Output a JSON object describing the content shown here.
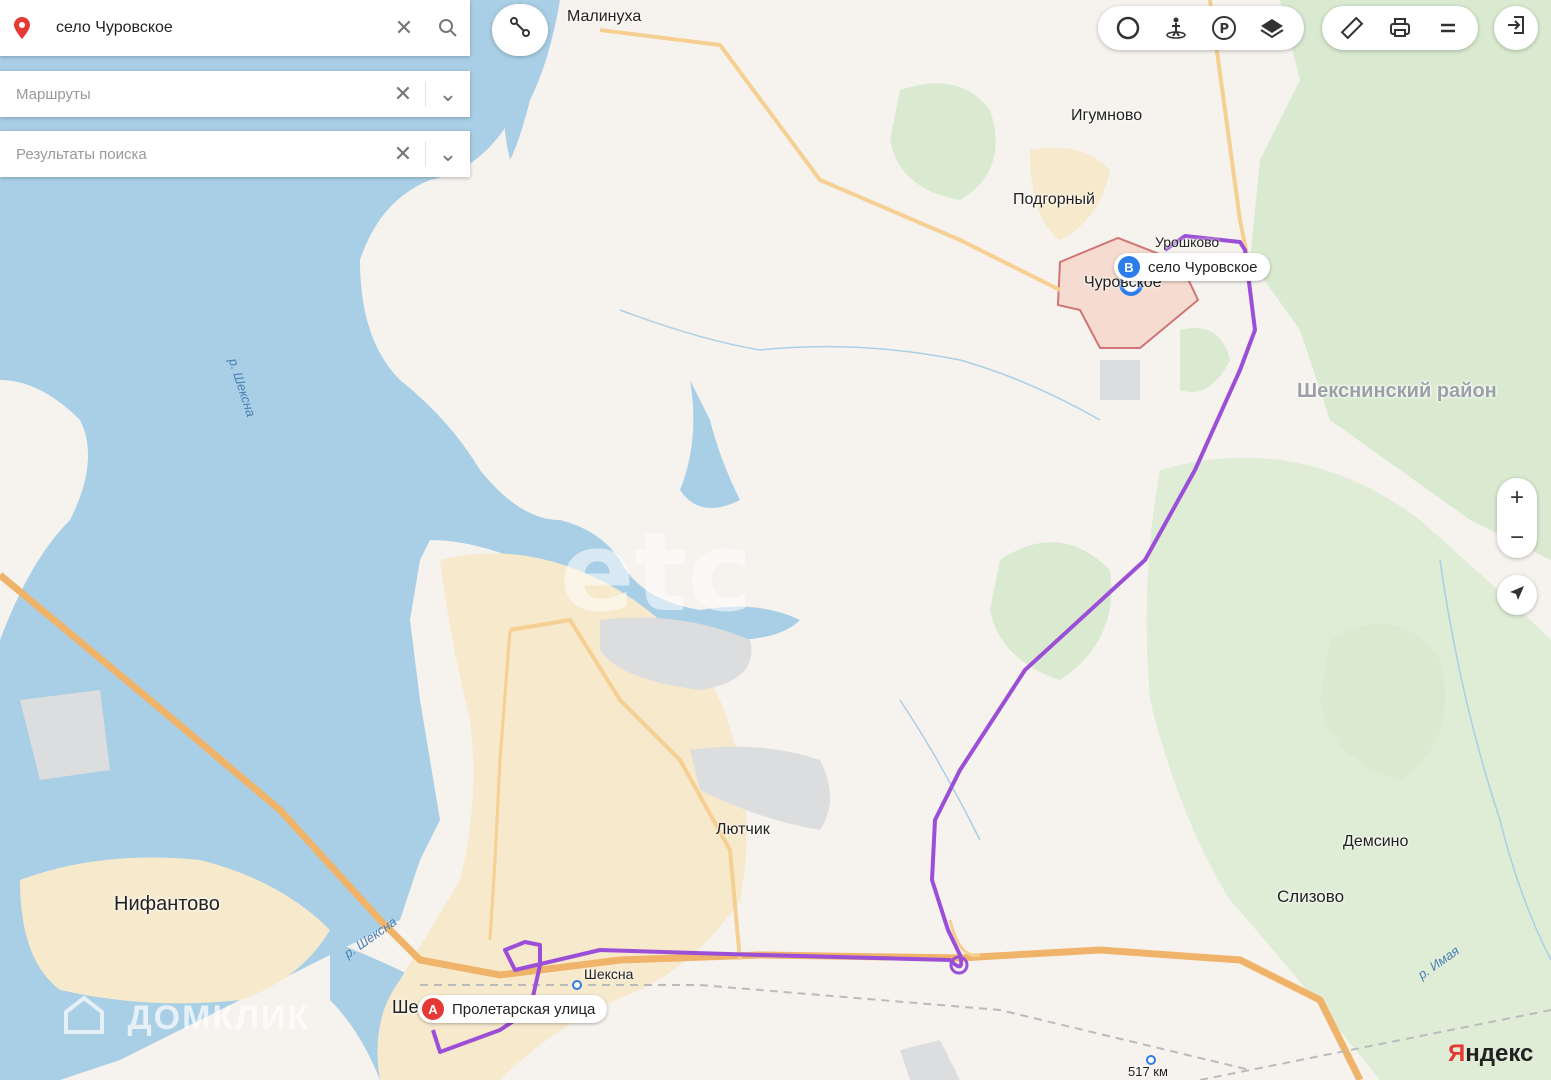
{
  "search": {
    "query": "село Чуровское"
  },
  "routes_panel": {
    "placeholder": "Маршруты"
  },
  "results_panel": {
    "placeholder": "Результаты поиска"
  },
  "toolbar": {
    "icons": [
      "traffic-icon",
      "panorama-icon",
      "parking-icon",
      "layers-icon",
      "ruler-icon",
      "print-icon",
      "menu-icon",
      "login-icon"
    ]
  },
  "zoom": {
    "in": "+",
    "out": "−"
  },
  "places": {
    "malinukha": "Малинуха",
    "igumnovo": "Игумново",
    "podgorny": "Подгорный",
    "uroshkovo": "Урошково",
    "churovskoe": "Чуровское",
    "district": "Шекснинский район",
    "lyutchik": "Лютчик",
    "demsino": "Демсино",
    "slizovo": "Слизово",
    "nifantovo": "Нифантово",
    "sheksna_station": "Шексна",
    "sheksna_city": "Ше",
    "km_post": "517 км"
  },
  "rivers": {
    "sheksna1": "р. Шексна",
    "sheksna2": "р. Шексна",
    "imaya": "р. Имая"
  },
  "route": {
    "start_letter": "A",
    "start_label": "Пролетарская улица",
    "end_letter": "B",
    "end_label": "село Чуровское",
    "color": "#9b4fd6"
  },
  "watermarks": {
    "domclick": "ДОМКЛИК",
    "etc": "etc"
  },
  "branding": {
    "logo": "Яндекс"
  },
  "colors": {
    "water": "#a9cfe6",
    "forest": "#d9ead0",
    "urban": "#f7e9cc",
    "road": "#f0b36a"
  }
}
